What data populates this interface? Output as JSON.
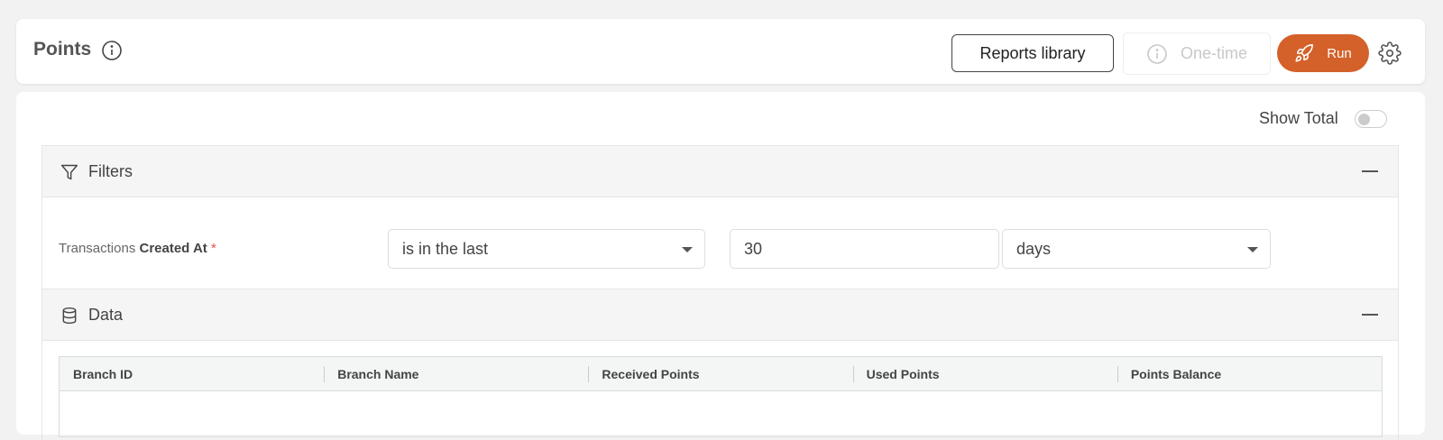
{
  "header": {
    "title": "Points",
    "reports_library_label": "Reports library",
    "one_time_label": "One-time",
    "run_label": "Run"
  },
  "colors": {
    "run_button": "#d4612a",
    "required_marker": "#e05050"
  },
  "options": {
    "show_total_label": "Show Total",
    "show_total_enabled": false
  },
  "filters": {
    "section_label": "Filters",
    "row": {
      "entity": "Transactions",
      "field": "Created At",
      "required_mark": "*",
      "operator": "is in the last",
      "value": "30",
      "unit": "days"
    }
  },
  "data": {
    "section_label": "Data",
    "columns": [
      "Branch ID",
      "Branch Name",
      "Received Points",
      "Used Points",
      "Points Balance"
    ],
    "rows": []
  },
  "icons": {
    "title_info": "info-icon",
    "one_time": "info-icon",
    "run": "rocket-icon",
    "settings": "gear-icon",
    "filters": "filter-icon",
    "data": "database-icon",
    "collapse": "minus-icon",
    "dropdown": "caret-down-icon"
  }
}
